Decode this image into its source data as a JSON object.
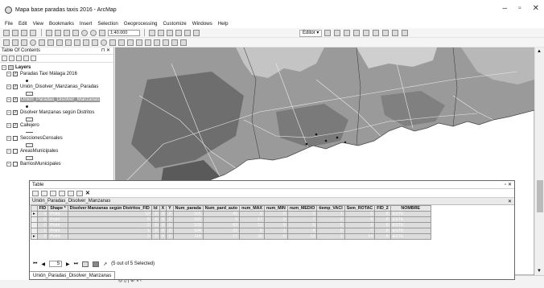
{
  "window": {
    "title": "Mapa base paradas taxis 2016 - ArcMap"
  },
  "menu": [
    "File",
    "Edit",
    "View",
    "Bookmarks",
    "Insert",
    "Selection",
    "Geoprocessing",
    "Customize",
    "Windows",
    "Help"
  ],
  "toolbar": {
    "scale": "1:40.000",
    "editor_label": "Editor ▾"
  },
  "toc": {
    "title": "Table Of Contents",
    "root": "Layers",
    "layers": [
      {
        "label": "Paradas Taxi Málaga 2016",
        "checked": true,
        "symbol": "point"
      },
      {
        "label": "Unión_Disolver_Manzanas_Paradas",
        "checked": true,
        "symbol": "polygon"
      },
      {
        "label": "Union_Paradas_Disolver_Manzanas",
        "checked": true,
        "symbol": "point",
        "selected": true
      },
      {
        "label": "Disolver Manzanas según Distritos",
        "checked": true,
        "symbol": "polygon"
      },
      {
        "label": "Callejero",
        "checked": true,
        "symbol": "line"
      },
      {
        "label": "SeccionesCensales",
        "checked": false,
        "symbol": "polygon"
      },
      {
        "label": "AreasMunicipales",
        "checked": false,
        "symbol": "polygon"
      },
      {
        "label": "BarriosMunicipales",
        "checked": false,
        "symbol": "polygon"
      }
    ]
  },
  "table": {
    "window_title": "Table",
    "tab_title": "Unión_Paradas_Disolver_Manzanas",
    "columns": [
      "FID",
      "Shape *",
      "Disolver Manzanas según Distritos_FID",
      "Id",
      "X",
      "Y",
      "Num_parada",
      "Num_pard_auto",
      "num_MAX",
      "num_MIN",
      "num_MEDIO",
      "tiemp_VACI",
      "Sem_ROTAC",
      "FID_2",
      "NOMBRE"
    ],
    "rows": [
      [
        "4",
        "Point",
        "12",
        "0",
        "0",
        "0",
        "101",
        "40",
        "9",
        "0",
        "3",
        "1",
        "6",
        "8",
        "ESTE"
      ],
      [
        "0",
        "Point",
        "8",
        "0",
        "0",
        "0",
        "102",
        "9",
        "17",
        "0",
        "7",
        "2",
        "6",
        "8",
        "ESTE"
      ],
      [
        "2",
        "Point",
        "2",
        "0",
        "0",
        "0",
        "103",
        "63",
        "12",
        "0",
        "5",
        "2",
        "2",
        "8",
        "ESTE"
      ],
      [
        "1",
        "Point",
        "1",
        "0",
        "0",
        "0",
        "104",
        "22",
        "8",
        "1",
        "4",
        "0",
        "7",
        "8",
        "ESTE"
      ],
      [
        "3",
        "Point",
        "3",
        "0",
        "0",
        "0",
        "114",
        "17",
        "32",
        "0",
        "13",
        "1",
        "14",
        "8",
        "ESTE"
      ]
    ],
    "current_record": "5",
    "selection_status": "(5 out of 5 Selected)",
    "bottom_tab": "Unión_Paradas_Disolver_Manzanas"
  },
  "map_status": "◎ ▯ | ⊘ ॥ ‹"
}
